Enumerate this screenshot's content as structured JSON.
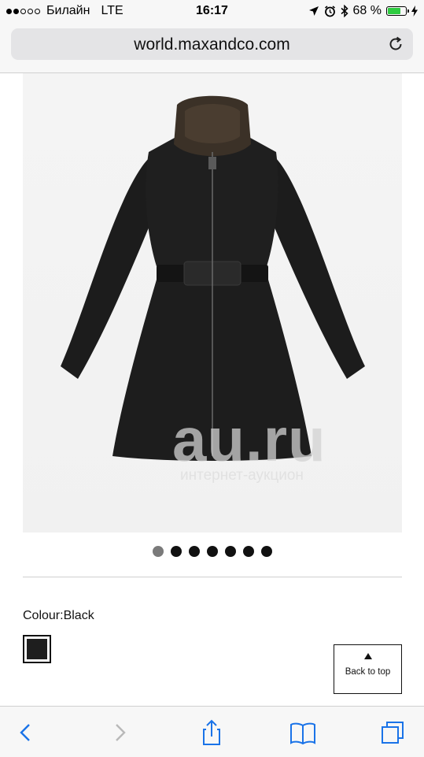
{
  "status_bar": {
    "carrier": "Билайн",
    "network": "LTE",
    "time": "16:17",
    "battery": "68 %",
    "signal_filled": 2,
    "signal_total": 5
  },
  "browser": {
    "url": "world.maxandco.com"
  },
  "product": {
    "image_alt": "black belted coat with fur collar",
    "watermark": "au.ru",
    "watermark_sub": "интернет-аукцион",
    "carousel_count": 7,
    "carousel_active_index": 0,
    "colour_label": "Colour:Black",
    "swatch_color": "#1e1e1e"
  },
  "back_to_top": {
    "label": "Back to top"
  },
  "toolbar": {
    "icons": [
      "back-icon",
      "forward-icon",
      "share-icon",
      "bookmarks-icon",
      "tabs-icon"
    ],
    "accent": "#1a73e8"
  }
}
